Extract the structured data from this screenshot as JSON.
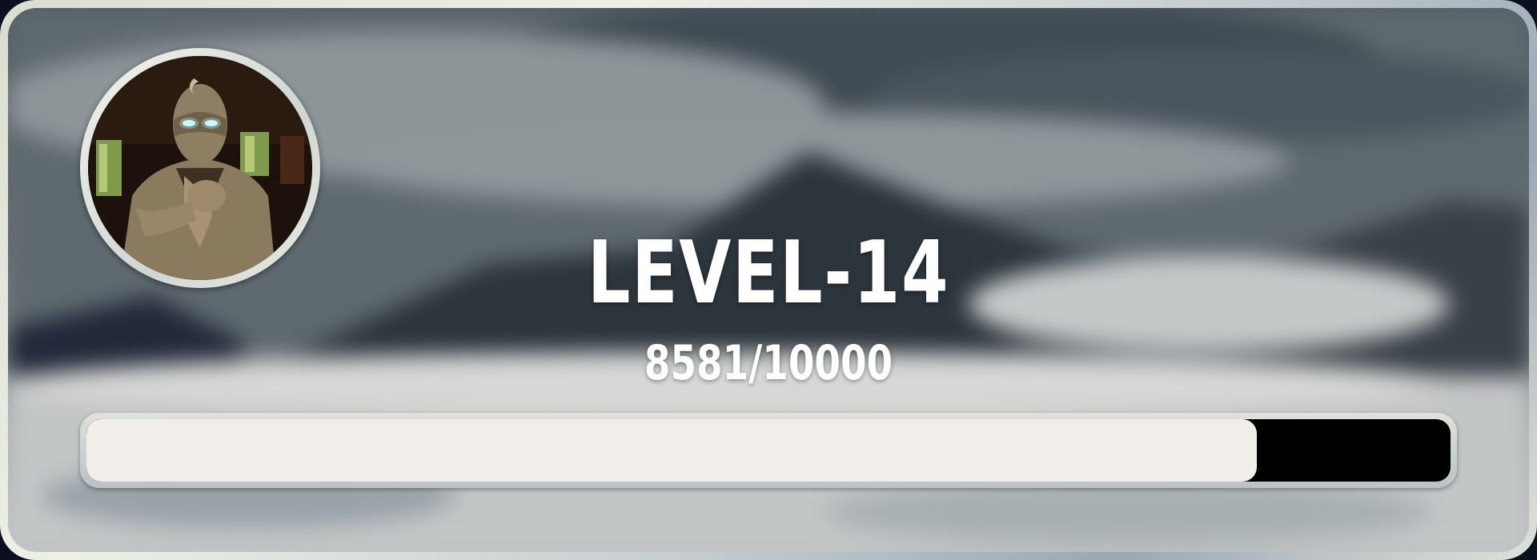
{
  "level": {
    "title": "LEVEL-14",
    "xp_text": "8581/10000",
    "progress_fraction": 0.8581
  },
  "avatar": {
    "icon": "masked-figure-avatar"
  },
  "colors": {
    "bar_fill": "#f1eeea",
    "bar_track": "#000000",
    "text": "#ffffff"
  }
}
